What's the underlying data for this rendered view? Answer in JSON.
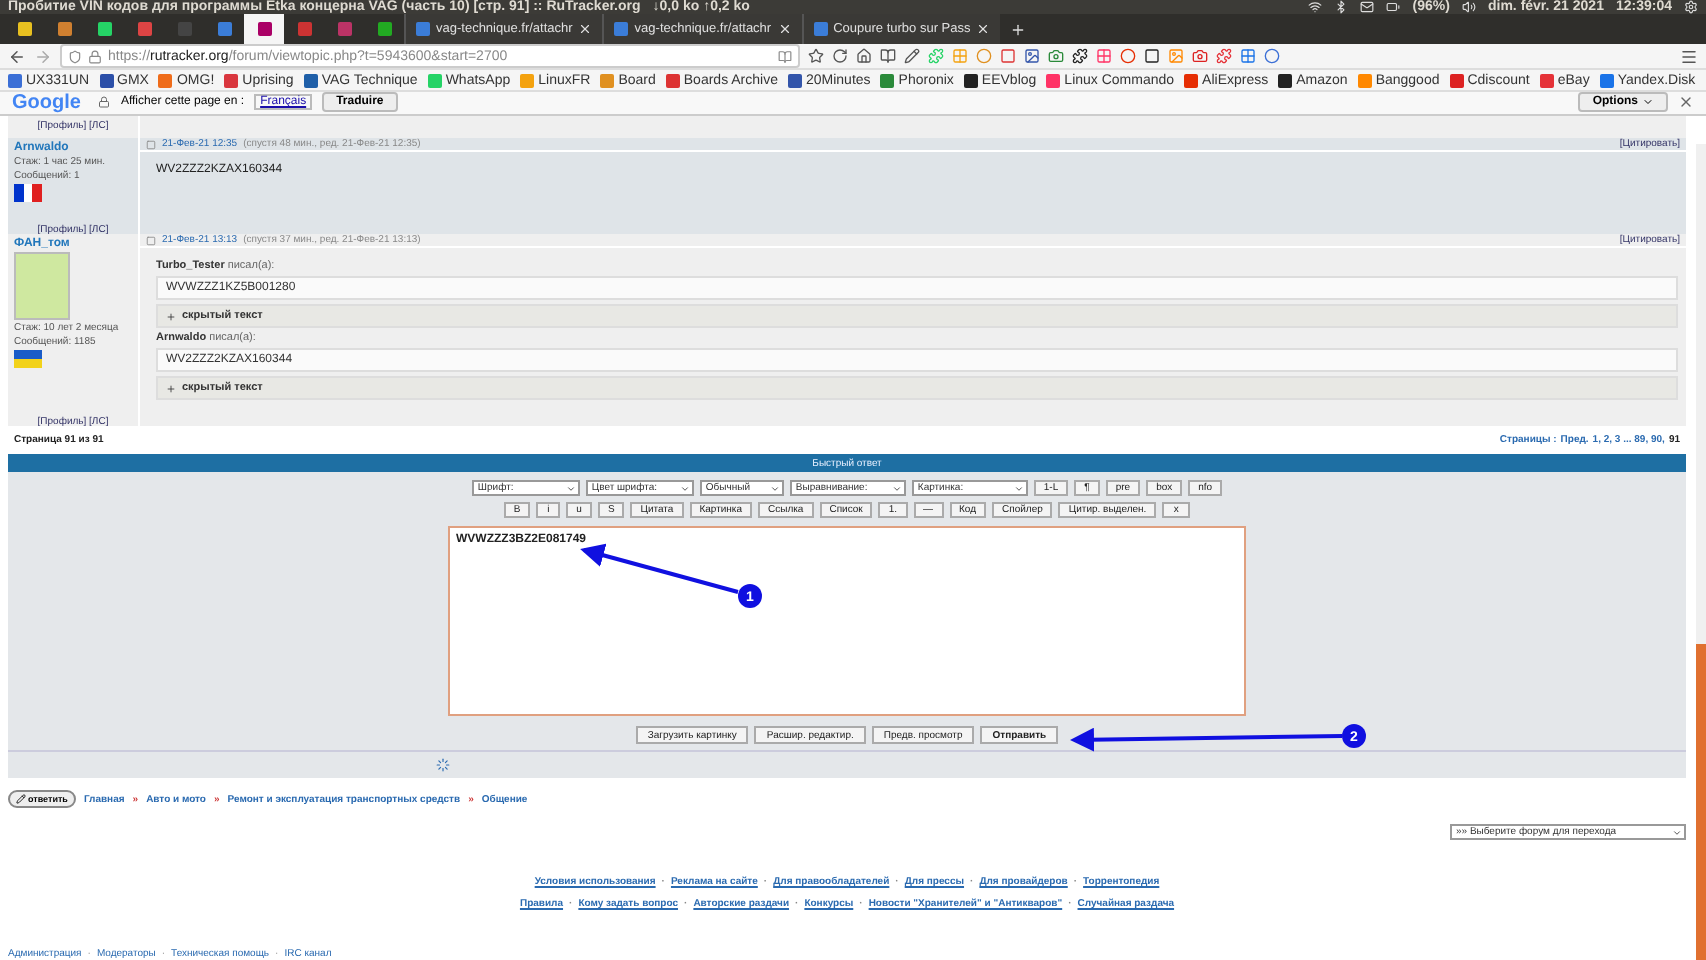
{
  "system_bar": {
    "title": "Пробитие VIN кодов для программы Etka концерна VAG (часть 10) [стр. 91] :: RuTracker.org",
    "network": "↓0,0 ko ↑0,2 ko",
    "battery": "(96%)",
    "date": "dim. févr. 21 2021",
    "time": "12:39:04"
  },
  "tabs": {
    "pinned": [
      {
        "selected": false
      },
      {
        "selected": false
      },
      {
        "selected": false
      },
      {
        "selected": false
      },
      {
        "selected": false
      },
      {
        "selected": false
      },
      {
        "selected": true
      },
      {
        "selected": false
      },
      {
        "selected": false
      },
      {
        "selected": false
      }
    ],
    "items": [
      {
        "label": "vag-technique.fr/attachr",
        "selected": false
      },
      {
        "label": "vag-technique.fr/attachr",
        "selected": false
      },
      {
        "label": "Coupure turbo sur Pass",
        "selected": false
      }
    ]
  },
  "address": {
    "url": "https://**rutracker.org**/forum/viewtopic.php?t=5943600&start=2700"
  },
  "bookmarks": [
    "UX331UN",
    "GMX",
    "OMG!",
    "Uprising",
    "VAG Technique",
    "WhatsApp",
    "LinuxFR",
    "Board",
    "Boards Archive",
    "20Minutes",
    "Phoronix",
    "EEVblog",
    "Linux Commando",
    "AliExpress",
    "Amazon",
    "Banggood",
    "Cdiscount",
    "eBay",
    "Yandex.Disk"
  ],
  "translate_bar": {
    "brand": "Google",
    "label": "Afficher cette page en :",
    "language": "Français",
    "button": "Traduire",
    "options": "Options"
  },
  "forum": {
    "top_links": [
      "[Профиль]",
      "[ЛС]"
    ],
    "posts": [
      {
        "author": "Arnwaldo",
        "stats": [
          "Стаж: 1 час 25 мин.",
          "Сообщений: 1"
        ],
        "flag": {
          "kind": "fr"
        },
        "avatar": false,
        "date": "21-Фев-21 12:35",
        "meta": "(спустя 48 мин., ред. 21-Фев-21 12:35)",
        "quote_link": "[Цитировать]",
        "body": [
          {
            "kind": "text",
            "text": "WV2ZZZ2KZAX160344"
          }
        ],
        "links": [
          "[Профиль]",
          "[ЛС]"
        ]
      },
      {
        "author": "ФАН_том",
        "stats": [
          "Стаж: 10 лет 2 месяца",
          "Сообщений: 1185"
        ],
        "flag": {
          "kind": "ua"
        },
        "avatar": true,
        "date": "21-Фев-21 13:13",
        "meta": "(спустя 37 мин., ред. 21-Фев-21 13:13)",
        "quote_link": "[Цитировать]",
        "body": [
          {
            "kind": "quote",
            "author": "Turbo_Tester",
            "wrote": "писал(а):",
            "text": "WVWZZZ1KZ5B001280",
            "spoiler": "скрытый текст"
          },
          {
            "kind": "quote",
            "author": "Arnwaldo",
            "wrote": "писал(а):",
            "text": "WV2ZZZ2KZAX160344",
            "spoiler": "скрытый текст"
          }
        ],
        "links": [
          "[Профиль]",
          "[ЛС]"
        ]
      }
    ],
    "page_info": "Страница 91 из 91",
    "pages_label": "Страницы :",
    "pages_prev": "Пред.",
    "pages": "1, 2, 3 ... 89, 90,",
    "page_current": "91"
  },
  "reply": {
    "title": "Быстрый ответ",
    "selects": [
      "Шрифт:",
      "Цвет шрифта:",
      "Обычный",
      "Выравнивание:",
      "Картинка:"
    ],
    "row1_buttons": [
      "1-L",
      "¶",
      "pre",
      "box",
      "nfo"
    ],
    "row2_buttons": [
      "B",
      "i",
      "u",
      "S",
      "Цитата",
      "Картинка",
      "Ссылка",
      "Список",
      "1.",
      "—",
      "Код",
      "Спойлер",
      "Цитир. выделен.",
      "x"
    ],
    "text": "WVWZZZ3BZ2E081749",
    "actions": [
      {
        "label": "Загрузить картинку",
        "primary": false
      },
      {
        "label": "Расшир. редактир.",
        "primary": false
      },
      {
        "label": "Предв. просмотр",
        "primary": false
      },
      {
        "label": "Отправить",
        "primary": true
      }
    ]
  },
  "annotations": [
    "1",
    "2"
  ],
  "bottom": {
    "reply_button": "ответить",
    "breadcrumb": [
      "Главная",
      "»",
      "Авто и мото",
      "»",
      "Ремонт и эксплуатация транспортных средств",
      "»",
      "Общение"
    ],
    "jump_select": "»» Выберите форум для перехода",
    "footer_rows": [
      [
        "Условия использования",
        "·",
        "Реклама на сайте",
        "·",
        "Для правообладателей",
        "·",
        "Для прессы",
        "·",
        "Для провайдеров",
        "·",
        "Торрентопедия"
      ],
      [
        "Правила",
        "·",
        "Кому задать вопрос",
        "·",
        "Авторские раздачи",
        "·",
        "Конкурсы",
        "·",
        "Новости \"Хранителей\" и \"Антикваров\"",
        "·",
        "Случайная раздача"
      ]
    ],
    "admin_links": [
      "Администрация",
      "·",
      "Модераторы",
      "·",
      "Техническая помощь",
      "·",
      "IRC канал"
    ]
  }
}
